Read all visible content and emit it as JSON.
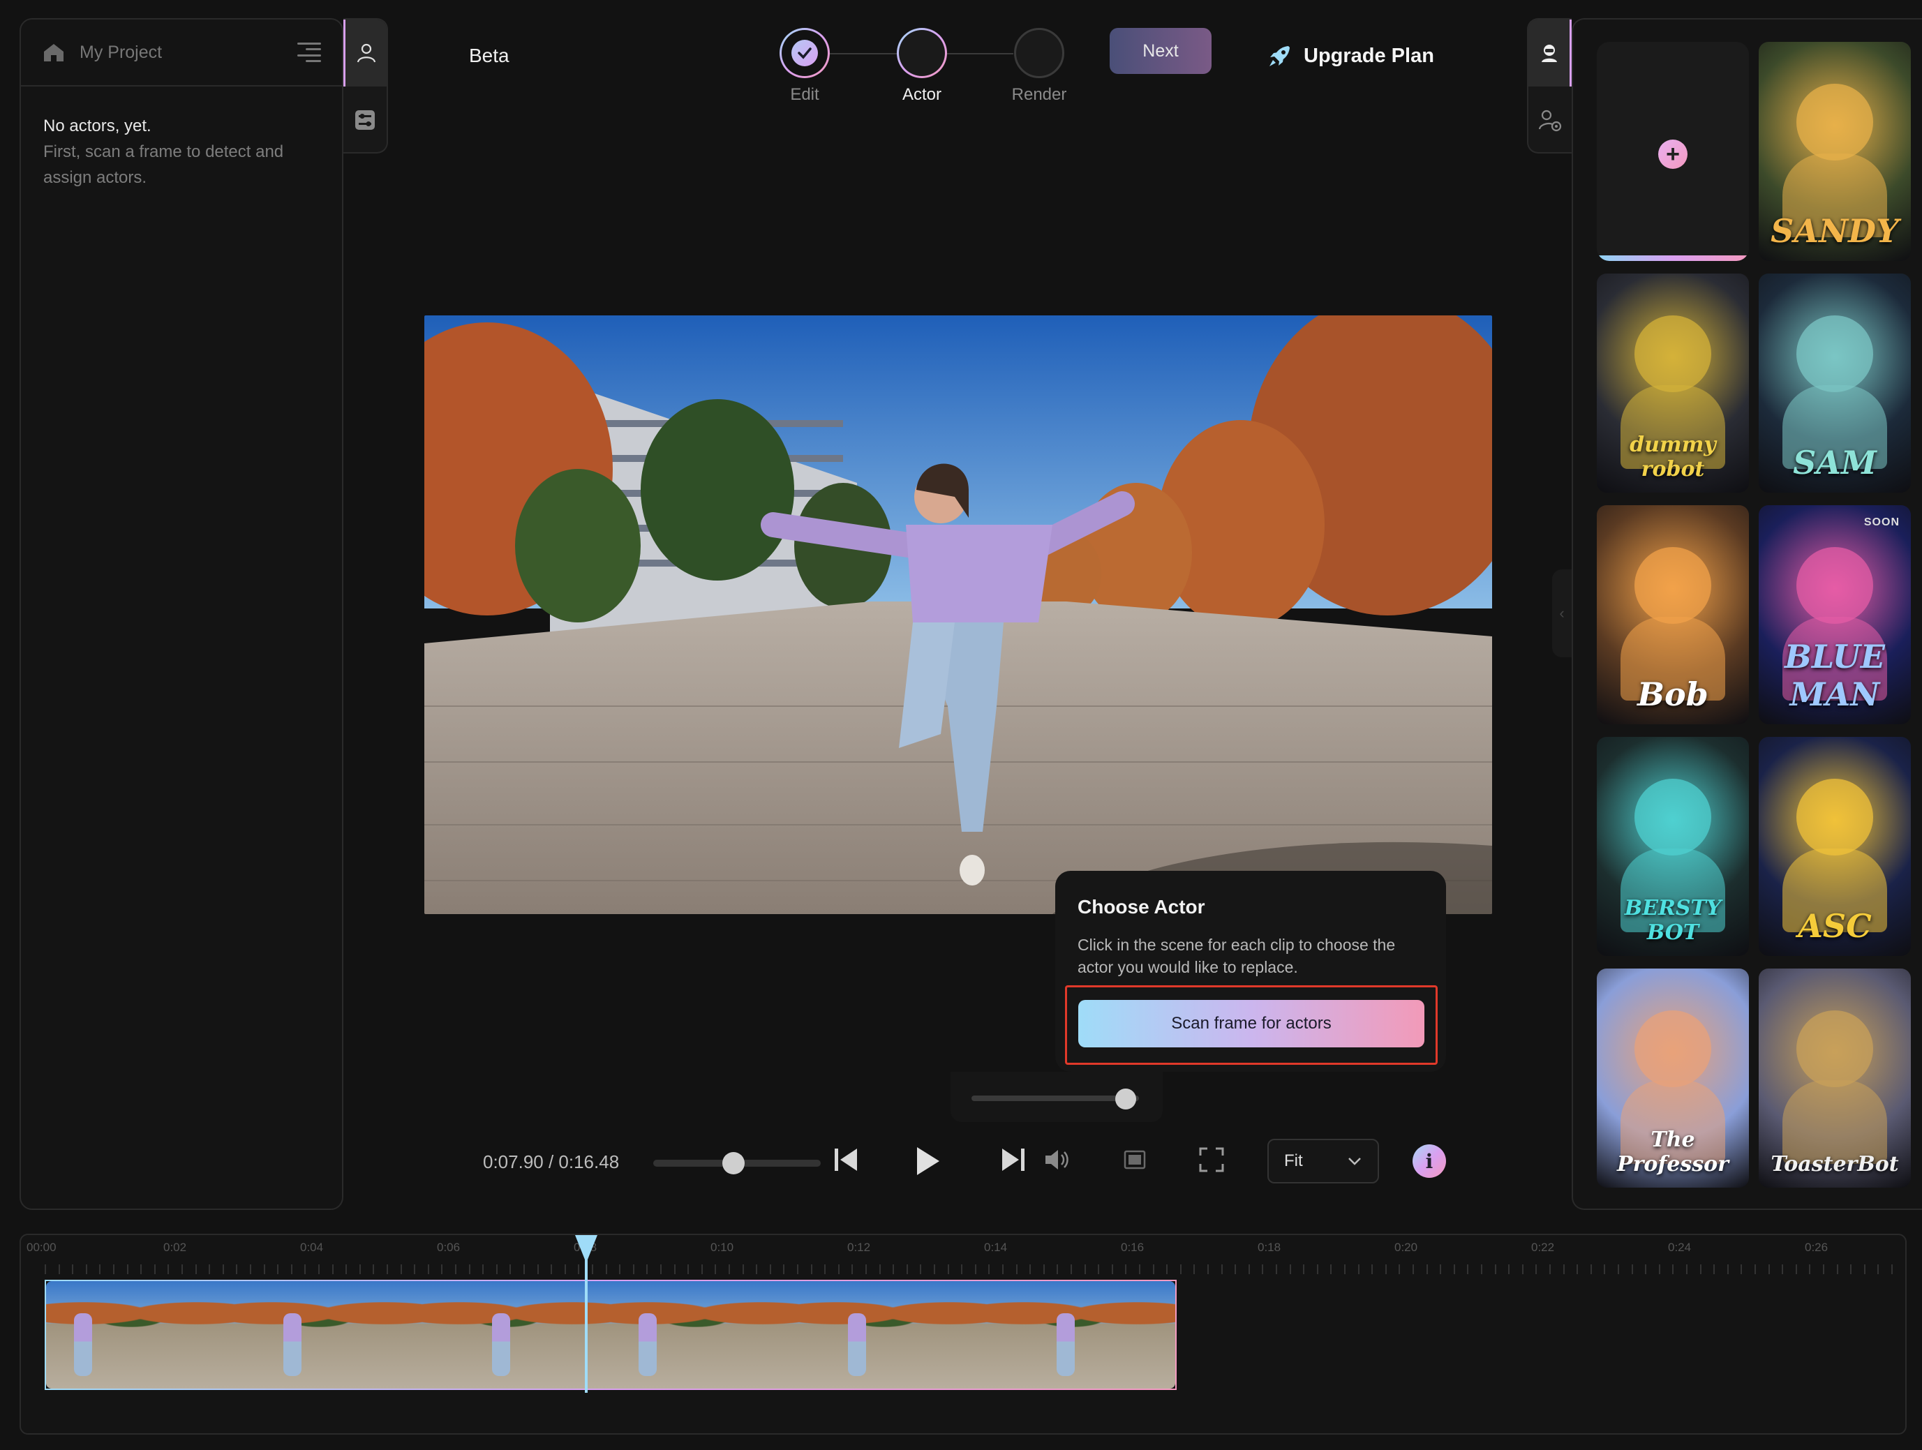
{
  "project": {
    "title": "My Project",
    "empty_title": "No actors, yet.",
    "empty_hint": "First, scan a frame to detect and assign actors."
  },
  "topbar": {
    "beta": "Beta",
    "steps": [
      {
        "label": "Edit",
        "state": "done"
      },
      {
        "label": "Actor",
        "state": "current"
      },
      {
        "label": "Render",
        "state": "pending"
      }
    ],
    "next_label": "Next",
    "upgrade_label": "Upgrade Plan"
  },
  "popup": {
    "title": "Choose Actor",
    "body": "Click in the scene for each clip to choose the actor you would like to replace.",
    "scan_label": "Scan frame for actors"
  },
  "player": {
    "current_time": "0:07.90",
    "total_time": "0:16.48",
    "time_display": "0:07.90 / 0:16.48",
    "scrub_fraction": 0.48,
    "zoom_fraction": 0.92,
    "fit_label": "Fit",
    "info_glyph": "i"
  },
  "actors": [
    {
      "name": "SANDY",
      "bg": "#3c4a2a",
      "accent": "#e7b04a",
      "color": "#f3b54a",
      "soon": false
    },
    {
      "name": "dummy robot",
      "bg": "#2a2c34",
      "accent": "#d4b23a",
      "color": "#f2d24a",
      "soon": false
    },
    {
      "name": "SAM",
      "bg": "#1c2a3a",
      "accent": "#7bc6c4",
      "color": "#8ee3d8",
      "soon": false
    },
    {
      "name": "Bob",
      "bg": "#5a3a22",
      "accent": "#f2a24a",
      "color": "#ffffff",
      "soon": false
    },
    {
      "name": "BLUE MAN",
      "bg": "#1a1f5a",
      "accent": "#e65ca6",
      "color": "#9fc8ff",
      "soon": true
    },
    {
      "name": "BERSTY BOT",
      "bg": "#1c2e2e",
      "accent": "#4fd0d0",
      "color": "#4fe0e0",
      "soon": false
    },
    {
      "name": "ASC",
      "bg": "#1a2248",
      "accent": "#f0c23a",
      "color": "#f5cc3a",
      "soon": false
    },
    {
      "name": "The Professor",
      "bg": "#8a9ed8",
      "accent": "#e8a27a",
      "color": "#ffffff",
      "soon": false
    },
    {
      "name": "ToasterBot",
      "bg": "#5a5a72",
      "accent": "#c8a05a",
      "color": "#f0f0f0",
      "soon": false
    }
  ],
  "soon_label": "SOON",
  "timeline": {
    "labels": [
      "00:00",
      "0:02",
      "0:04",
      "0:06",
      "0:08",
      "0:10",
      "0:12",
      "0:14",
      "0:16",
      "0:18",
      "0:20",
      "0:22",
      "0:24",
      "0:26"
    ],
    "clip_frames": 6,
    "playhead_time": "0:07.90"
  },
  "icons": {
    "home": "home-icon",
    "menu": "menu-icon",
    "person": "person-icon",
    "sliders": "sliders-icon",
    "rocket": "rocket-icon",
    "actor_lib": "actor-library-icon",
    "actor_settings": "actor-settings-icon"
  }
}
